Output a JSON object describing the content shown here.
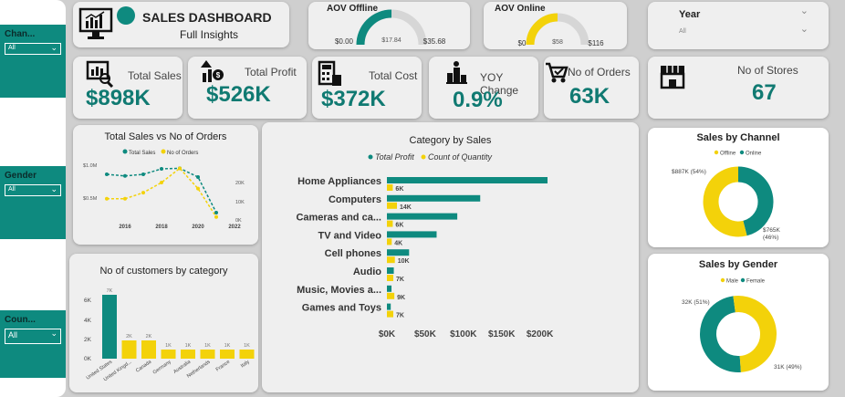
{
  "colors": {
    "teal": "#0e8a7f",
    "gold": "#f3d20a",
    "value": "#107a72"
  },
  "slicers": [
    {
      "title": "Chan...",
      "value": "All"
    },
    {
      "title": "Gender",
      "value": "All"
    },
    {
      "title": "Coun...",
      "value": "All"
    }
  ],
  "header": {
    "title": "SALES DASHBOARD",
    "subtitle": "Full Insights",
    "icon": "monitor-chart-icon"
  },
  "aov_offline": {
    "title": "AOV Offline",
    "min": "$0.00",
    "value": "$17.84",
    "max": "$35.68",
    "fraction": 0.5
  },
  "aov_online": {
    "title": "AOV Online",
    "min": "$0",
    "value": "$58",
    "max": "$116",
    "fraction": 0.5
  },
  "year_slicer": {
    "title": "Year",
    "value": "All"
  },
  "kpis": {
    "total_sales": {
      "label": "Total Sales",
      "value": "$898K",
      "icon": "sales-report-icon"
    },
    "total_profit": {
      "label": "Total Profit",
      "value": "$526K",
      "icon": "profit-up-icon"
    },
    "total_cost": {
      "label": "Total Cost",
      "value": "$372K",
      "icon": "calculator-icon"
    },
    "yoy_change": {
      "label": "YOY Change",
      "value": "0.9%",
      "icon": "podium-icon"
    },
    "no_of_orders": {
      "label": "No of Orders",
      "value": "63K",
      "icon": "cart-icon"
    },
    "no_of_stores": {
      "label": "No of Stores",
      "value": "67",
      "icon": "store-icon"
    }
  },
  "chart_data": [
    {
      "type": "line",
      "title": "Total Sales vs No of Orders",
      "x": [
        2015,
        2016,
        2017,
        2018,
        2019,
        2020,
        2021
      ],
      "xticks": [
        "2016",
        "2018",
        "2020",
        "2022"
      ],
      "series": [
        {
          "name": "Total Sales",
          "axis": "left",
          "values": [
            0.75,
            0.72,
            0.75,
            0.85,
            0.86,
            0.7,
            0.05
          ]
        },
        {
          "name": "No of Orders",
          "axis": "right",
          "values": [
            10,
            10,
            13,
            18,
            25,
            15,
            1
          ]
        }
      ],
      "yticks_left": [
        "$1.0M",
        "$0.5M"
      ],
      "yticks_right": [
        "20K",
        "10K",
        "0K"
      ],
      "ylim_left": [
        0,
        1.0
      ],
      "ylim_right": [
        0,
        27
      ],
      "legend": "top"
    },
    {
      "type": "bar",
      "title": "Category by Sales",
      "orientation": "horizontal",
      "categories": [
        "Home Appliances",
        "Computers",
        "Cameras and ca...",
        "TV and Video",
        "Cell phones",
        "Audio",
        "Music, Movies a...",
        "Games and Toys"
      ],
      "series": [
        {
          "name": "Total Profit",
          "values": [
            210,
            122,
            92,
            65,
            29,
            9,
            6,
            5
          ]
        },
        {
          "name": "Count of Quantity",
          "values": [
            6,
            14,
            6,
            4,
            10,
            7,
            9,
            7
          ]
        }
      ],
      "quantity_labels": [
        "6K",
        "14K",
        "6K",
        "4K",
        "10K",
        "7K",
        "9K",
        "7K"
      ],
      "xticks": [
        "$0K",
        "$50K",
        "$100K",
        "$150K",
        "$200K"
      ],
      "xlim": [
        0,
        210
      ],
      "legend": "top"
    },
    {
      "type": "bar",
      "title": "No of customers by category",
      "categories": [
        "United States",
        "United Kingd...",
        "Canada",
        "Germany",
        "Australia",
        "Netherlands",
        "France",
        "Italy"
      ],
      "values": [
        7,
        2,
        2,
        1,
        1,
        1,
        1,
        1
      ],
      "data_labels": [
        "7K",
        "2K",
        "2K",
        "1K",
        "1K",
        "1K",
        "1K",
        "1K"
      ],
      "yticks": [
        "6K",
        "4K",
        "2K",
        "0K"
      ],
      "ylim": [
        0,
        7
      ]
    },
    {
      "type": "pie",
      "title": "Sales by Channel",
      "labels": [
        "Offline",
        "Online"
      ],
      "values": [
        54,
        46
      ],
      "data_labels": [
        "$887K (54%)",
        "$765K (46%)"
      ],
      "legend": "top"
    },
    {
      "type": "pie",
      "title": "Sales by Gender",
      "labels": [
        "Male",
        "Female"
      ],
      "values": [
        51,
        49
      ],
      "data_labels": [
        "32K (51%)",
        "31K (49%)"
      ],
      "legend": "top"
    }
  ]
}
